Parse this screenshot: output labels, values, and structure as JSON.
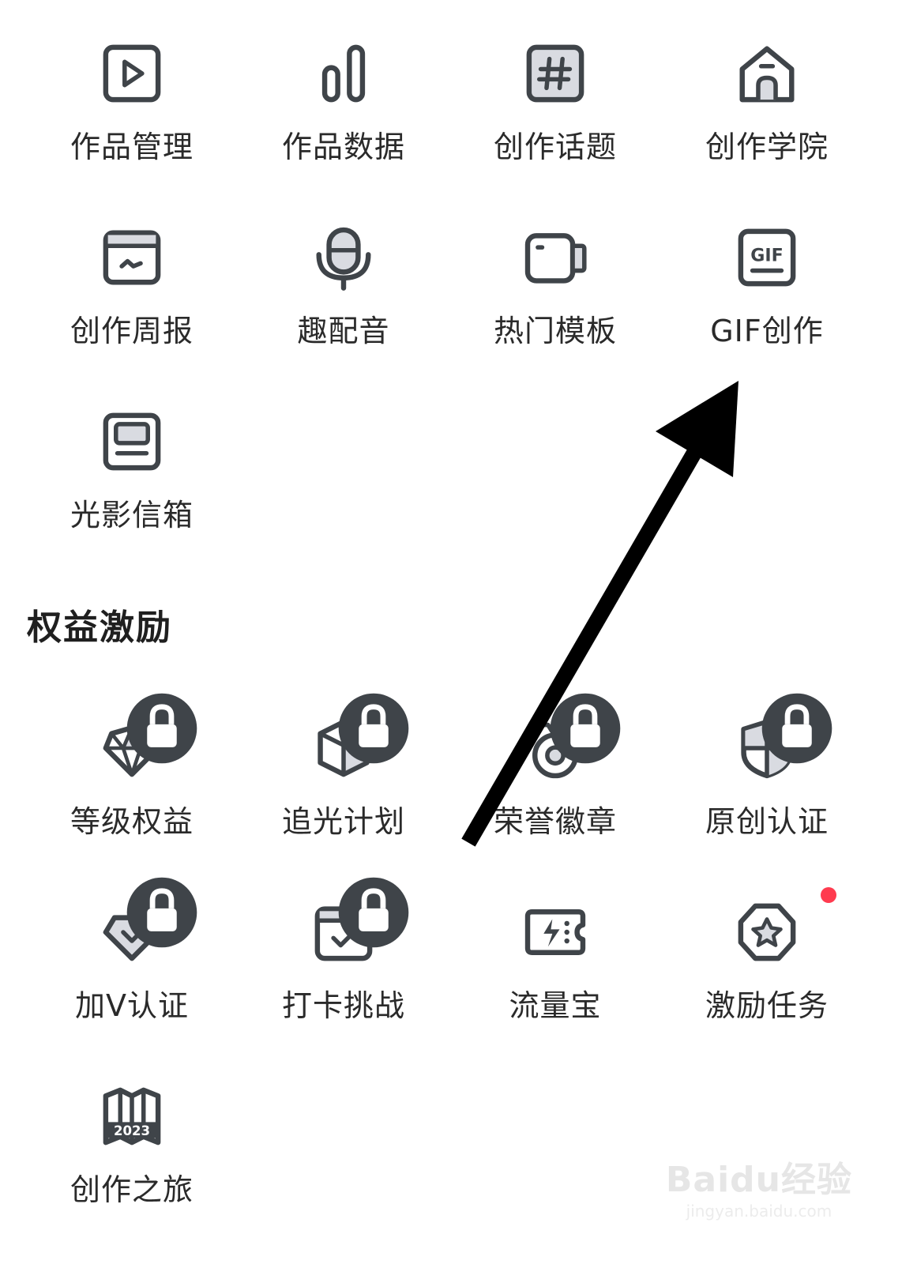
{
  "create_tools": [
    {
      "label": "作品管理",
      "icon": "play-square-icon"
    },
    {
      "label": "作品数据",
      "icon": "bar-chart-icon"
    },
    {
      "label": "创作话题",
      "icon": "hashtag-icon"
    },
    {
      "label": "创作学院",
      "icon": "house-icon"
    },
    {
      "label": "创作周报",
      "icon": "report-window-icon"
    },
    {
      "label": "趣配音",
      "icon": "microphone-icon"
    },
    {
      "label": "热门模板",
      "icon": "camera-template-icon"
    },
    {
      "label": "GIF创作",
      "icon": "gif-icon"
    },
    {
      "label": "光影信箱",
      "icon": "mailbox-icon"
    }
  ],
  "rights_section": {
    "title": "权益激励",
    "items": [
      {
        "label": "等级权益",
        "icon": "diamond-icon",
        "locked": true
      },
      {
        "label": "追光计划",
        "icon": "cube-icon",
        "locked": true
      },
      {
        "label": "荣誉徽章",
        "icon": "badge-icon",
        "locked": true
      },
      {
        "label": "原创认证",
        "icon": "shield-icon",
        "locked": true
      },
      {
        "label": "加V认证",
        "icon": "v-heart-icon",
        "locked": true
      },
      {
        "label": "打卡挑战",
        "icon": "calendar-check-icon",
        "locked": true
      },
      {
        "label": "流量宝",
        "icon": "lightning-ticket-icon",
        "locked": false
      },
      {
        "label": "激励任务",
        "icon": "star-octagon-icon",
        "locked": false,
        "notification_dot": true
      },
      {
        "label": "创作之旅",
        "icon": "map-2023-icon",
        "locked": false,
        "icon_text": "2023"
      }
    ]
  },
  "watermark": {
    "main": "Baidu经验",
    "sub": "jingyan.baidu.com"
  },
  "colors": {
    "icon_stroke": "#3f4449",
    "icon_fill": "#d9dbe1",
    "dot": "#ff3b4f",
    "arrow": "#000000"
  }
}
